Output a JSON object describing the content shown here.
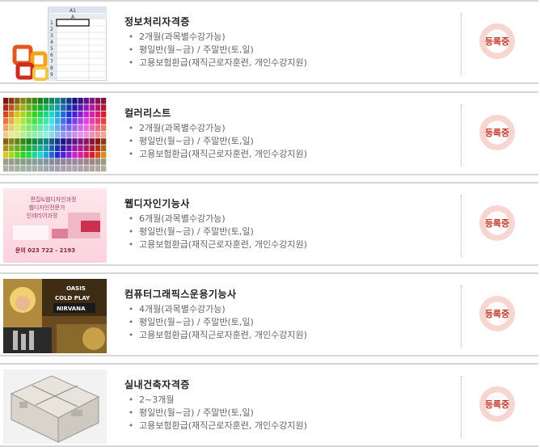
{
  "courses": [
    {
      "title": "정보처리자격증",
      "details": [
        "2개월(과목별수강가능)",
        "평일반(월~금) / 주말반(토,일)",
        "고용보험환급(재직근로자훈련, 개인수강지원)"
      ],
      "status": "등록중",
      "thumb": {
        "cell_ref": "A1",
        "col_header": "A",
        "rows": [
          "1",
          "2",
          "3",
          "4",
          "5",
          "6",
          "7",
          "8",
          "9"
        ]
      }
    },
    {
      "title": "컬러리스트",
      "details": [
        "2개월(과목별수강가능)",
        "평일반(월~금) / 주말반(토,일)",
        "고용보험환급(재직근로자훈련, 개인수강지원)"
      ],
      "status": "등록중"
    },
    {
      "title": "웹디자인기능사",
      "details": [
        "6개월(과목별수강가능)",
        "평일반(월~금) / 주말반(토,일)",
        "고용보험환급(재직근로자훈련, 개인수강지원)"
      ],
      "status": "등록중",
      "thumb": {
        "line1": "편집&웹디자인과정",
        "line2": "웹디자인전문가",
        "line3": "인테리어과정",
        "phone": "문의 023 722 - 2193"
      }
    },
    {
      "title": "컴퓨터그래픽스운용기능사",
      "details": [
        "4개월(과목별수강가능)",
        "평일반(월~금) / 주말반(토,일)",
        "고용보험환급(재직근로자훈련, 개인수강지원)"
      ],
      "status": "등록중",
      "thumb": {
        "words": [
          "OASIS",
          "COLD PLAY",
          "NIRVANA"
        ]
      }
    },
    {
      "title": "실내건축자격증",
      "details": [
        "2~3개월",
        "평일반(월~금) / 주말반(토,일)",
        "고용보험환급(재직근로자훈련, 개인수강지원)"
      ],
      "status": "등록중"
    }
  ],
  "colors": {
    "badge_text": "#c63a2c",
    "badge_ring": "#f7d6d2",
    "title": "#222222",
    "detail": "#666666"
  }
}
